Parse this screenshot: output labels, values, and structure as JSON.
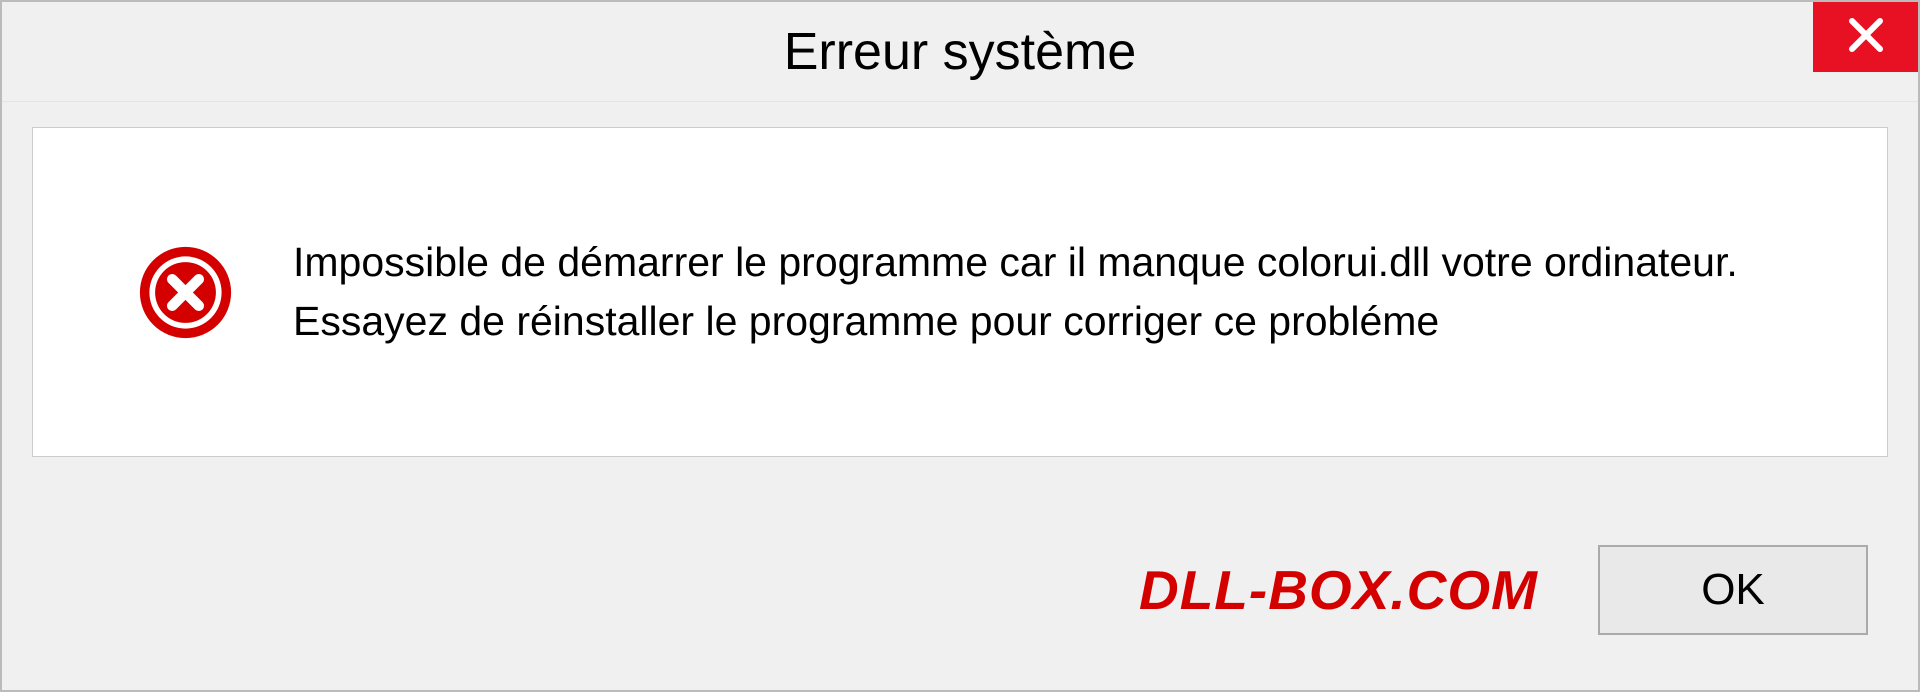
{
  "dialog": {
    "title": "Erreur système",
    "message": "Impossible de démarrer le programme car il manque colorui.dll votre ordinateur. Essayez de réinstaller le programme pour corriger ce probléme",
    "ok_label": "OK"
  },
  "watermark": "DLL-BOX.COM",
  "colors": {
    "close_button": "#e81123",
    "error_icon": "#d40000",
    "watermark": "#d40000"
  }
}
